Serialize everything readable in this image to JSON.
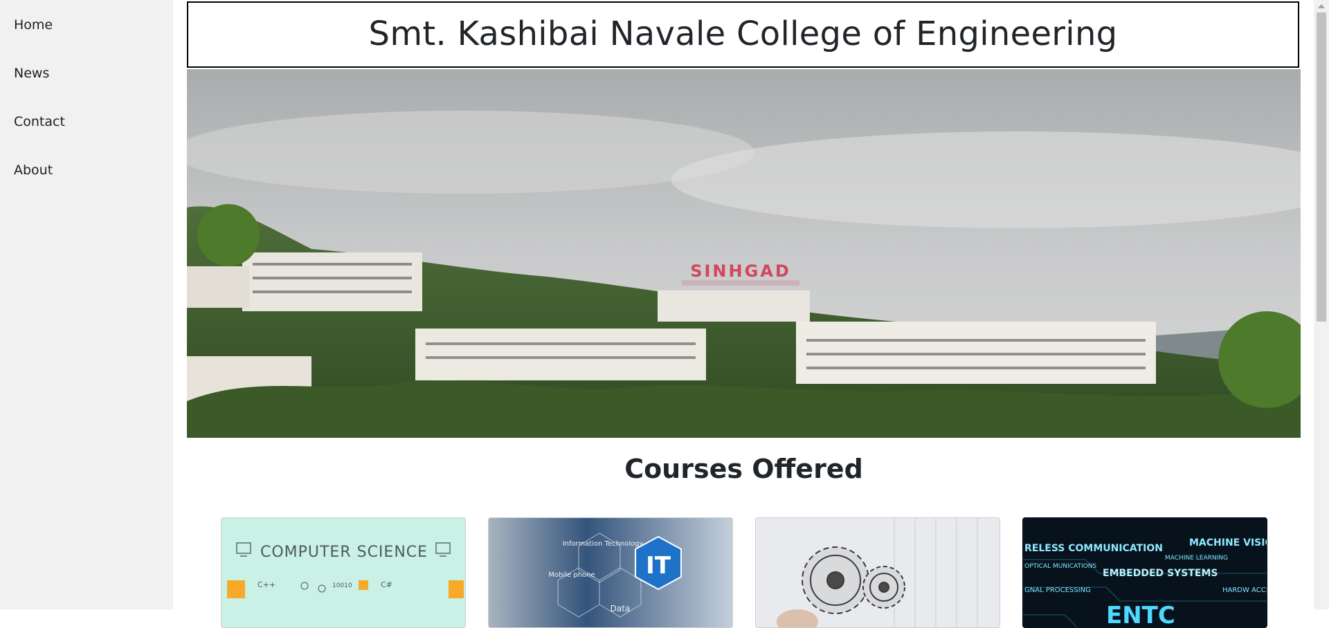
{
  "sidebar": {
    "items": [
      {
        "label": "Home"
      },
      {
        "label": "News"
      },
      {
        "label": "Contact"
      },
      {
        "label": "About"
      }
    ]
  },
  "header": {
    "title": "Smt. Kashibai Navale College of Engineering"
  },
  "hero": {
    "sign_text": "SINHGAD"
  },
  "courses": {
    "heading": "Courses Offered",
    "cards": [
      {
        "banner": "COMPUTER SCIENCE",
        "tags": [
          "C++",
          "C#",
          "10010"
        ]
      },
      {
        "banner": "IT",
        "tags": [
          "Information Technology",
          "Mobile phone",
          "Data"
        ]
      },
      {
        "banner": "",
        "tags": []
      },
      {
        "banner": "ENTC",
        "tags": [
          "RELESS COMMUNICATION",
          "MACHINE VISIO",
          "MACHINE LEARNING",
          "EMBEDDED SYSTEMS",
          "OPTICAL MUNICATIONS",
          "GNAL PROCESSING",
          "HARDW ACCELERA"
        ]
      }
    ]
  },
  "colors": {
    "sidebar_bg": "#f1f1f1",
    "text": "#212529",
    "cs_bg": "#c9f1e6",
    "entc_bg": "#08121d",
    "entc_text": "#7fe8ff"
  }
}
